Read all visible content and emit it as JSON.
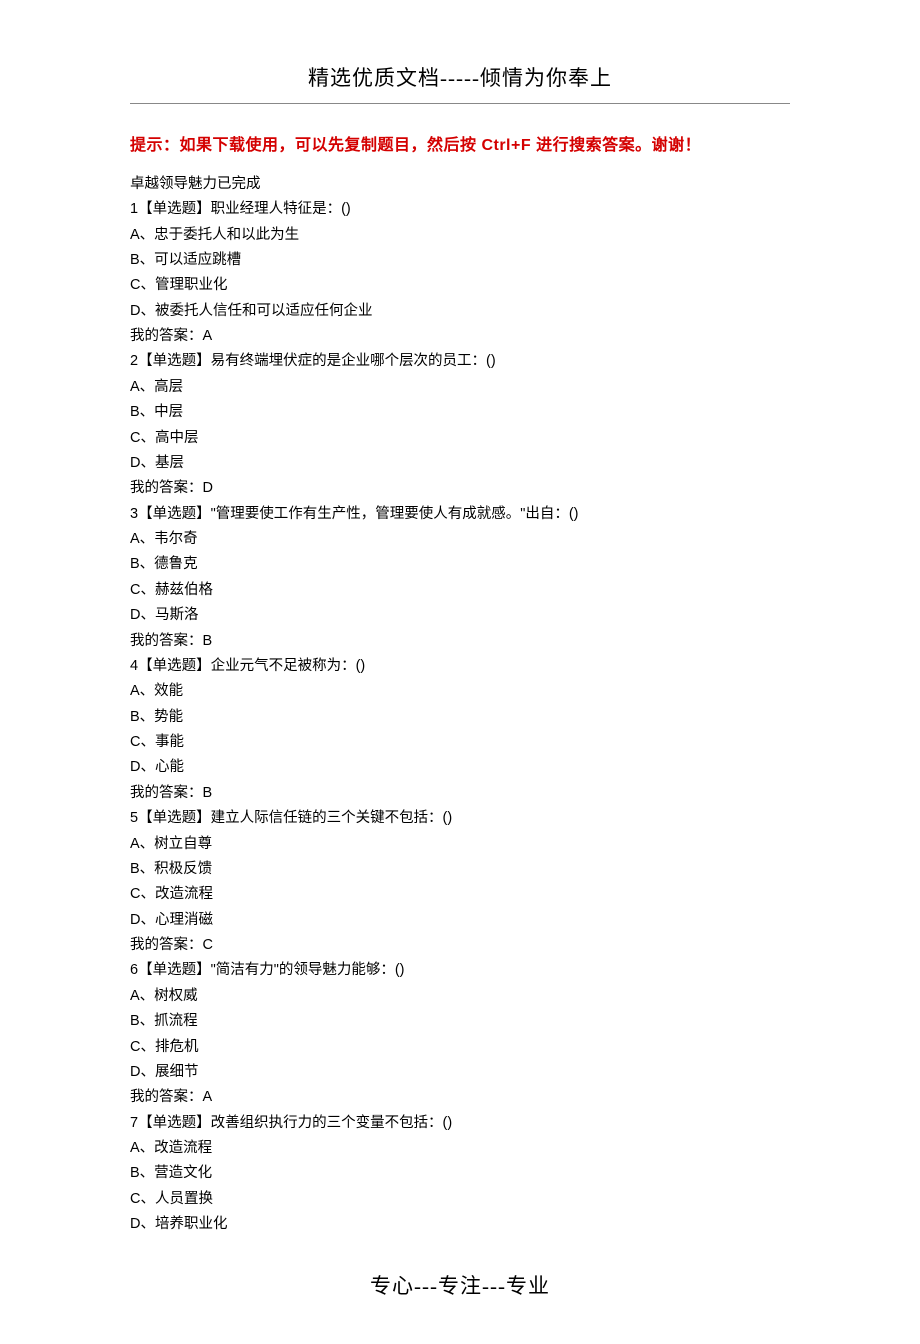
{
  "header": "精选优质文档-----倾情为你奉上",
  "hint": "提示：如果下载使用，可以先复制题目，然后按 Ctrl+F 进行搜索答案。谢谢！",
  "intro": "卓越领导魅力已完成",
  "questions": [
    {
      "num": "1",
      "type": "【单选题】",
      "text": "职业经理人特征是：()",
      "options": [
        "A、忠于委托人和以此为生",
        "B、可以适应跳槽",
        "C、管理职业化",
        "D、被委托人信任和可以适应任何企业"
      ],
      "answer": "我的答案：A"
    },
    {
      "num": "2",
      "type": "【单选题】",
      "text": "易有终端埋伏症的是企业哪个层次的员工：()",
      "options": [
        "A、高层",
        "B、中层",
        "C、高中层",
        "D、基层"
      ],
      "answer": "我的答案：D"
    },
    {
      "num": "3",
      "type": "【单选题】",
      "text": "\"管理要使工作有生产性，管理要使人有成就感。\"出自：()",
      "options": [
        "A、韦尔奇",
        "B、德鲁克",
        "C、赫兹伯格",
        "D、马斯洛"
      ],
      "answer": "我的答案：B"
    },
    {
      "num": "4",
      "type": "【单选题】",
      "text": "企业元气不足被称为：()",
      "options": [
        "A、效能",
        "B、势能",
        "C、事能",
        "D、心能"
      ],
      "answer": "我的答案：B"
    },
    {
      "num": "5",
      "type": "【单选题】",
      "text": "建立人际信任链的三个关键不包括：()",
      "options": [
        "A、树立自尊",
        "B、积极反馈",
        "C、改造流程",
        "D、心理消磁"
      ],
      "answer": "我的答案：C"
    },
    {
      "num": "6",
      "type": "【单选题】",
      "text": "\"简洁有力\"的领导魅力能够：()",
      "options": [
        "A、树权威",
        "B、抓流程",
        "C、排危机",
        "D、展细节"
      ],
      "answer": "我的答案：A"
    },
    {
      "num": "7",
      "type": "【单选题】",
      "text": "改善组织执行力的三个变量不包括：()",
      "options": [
        "A、改造流程",
        "B、营造文化",
        "C、人员置换",
        "D、培养职业化"
      ],
      "answer": ""
    }
  ],
  "footer": "专心---专注---专业"
}
